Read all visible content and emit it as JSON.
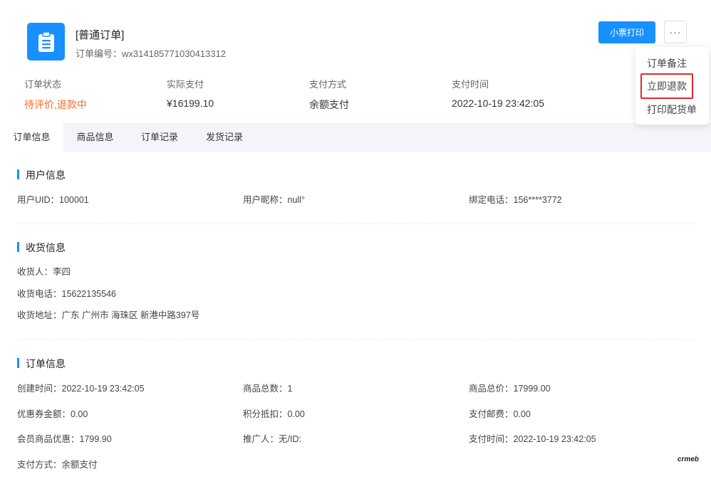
{
  "header": {
    "title": "[普通订单]",
    "order_no_label": "订单编号：",
    "order_no": "wx314185771030413312",
    "icon": "clipboard-icon",
    "print_button": "小票打印",
    "more_button": "···"
  },
  "dropdown": {
    "items": [
      {
        "label": "订单备注"
      },
      {
        "label": "立即退款"
      },
      {
        "label": "打印配货单"
      }
    ]
  },
  "summary": [
    {
      "label": "订单状态",
      "value": "待评价,退款中"
    },
    {
      "label": "实际支付",
      "value": "¥16199.10"
    },
    {
      "label": "支付方式",
      "value": "余额支付"
    },
    {
      "label": "支付时间",
      "value": "2022-10-19 23:42:05"
    }
  ],
  "tabs": [
    {
      "label": "订单信息"
    },
    {
      "label": "商品信息"
    },
    {
      "label": "订单记录"
    },
    {
      "label": "发货记录"
    }
  ],
  "user_info": {
    "title": "用户信息",
    "uid": "用户UID：100001",
    "nickname": "用户昵称：null°",
    "phone": "绑定电话：156****3772"
  },
  "shipping_info": {
    "title": "收货信息",
    "receiver": "收货人：李四",
    "phone": "收货电话：15622135546",
    "address": "收货地址：广东 广州市 海珠区 新港中路397号"
  },
  "order_info": {
    "title": "订单信息",
    "created": "创建时间：2022-10-19 23:42:05",
    "total_count": "商品总数：1",
    "total_price": "商品总价：17999.00",
    "coupon": "优惠券金额：0.00",
    "points": "积分抵扣：0.00",
    "postage": "支付邮费：0.00",
    "member_discount": "会员商品优惠：1799.90",
    "promoter": "推广人：无/ID:",
    "pay_time": "支付时间：2022-10-19 23:42:05",
    "pay_method": "支付方式：余额支付"
  },
  "logo_text": "crmeb",
  "colors": {
    "primary": "#1890ff",
    "status": "#f56a1f",
    "highlight": "#e5272b"
  }
}
